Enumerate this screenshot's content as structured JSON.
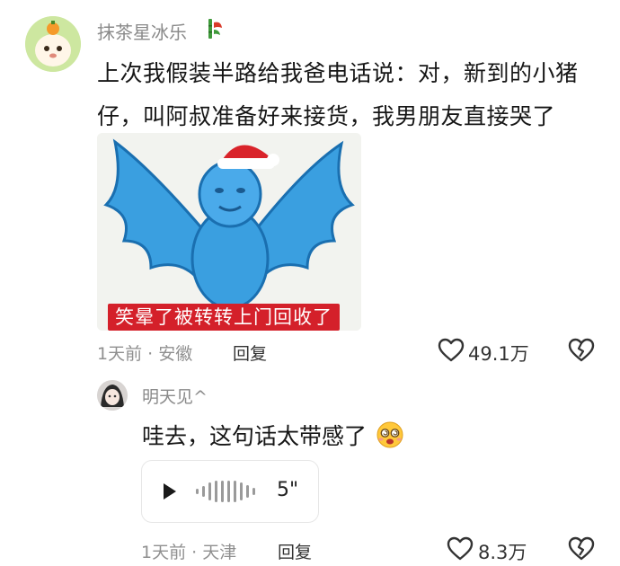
{
  "comment": {
    "username": "抹茶星冰乐",
    "line1": "上次我假装半路给我爸电话说：对，新到的小猪",
    "line2": "仔，叫阿叔准备好来接货，我男朋友直接哭了",
    "meme_caption": "笑晕了被转转上门回收了",
    "time_location": "1天前 · 安徽",
    "reply_label": "回复",
    "likes": "49.1万"
  },
  "reply": {
    "username": "明天见^",
    "text": "哇去，这句话太带感了",
    "voice_duration": "5\"",
    "time_location": "1天前 · 天津",
    "reply_label": "回复",
    "likes": "8.3万"
  },
  "icons": {
    "like": "heart-outline-icon",
    "dislike": "broken-heart-icon",
    "play": "play-icon",
    "waveform": "waveform-icon",
    "badge": "bamboo-badge-icon",
    "emoji": "dizzy-face-emoji-icon"
  },
  "colors": {
    "caption_bg": "#d4202a",
    "meme_bird": "#3a9fe0",
    "meta_gray": "#8f8f8f"
  }
}
